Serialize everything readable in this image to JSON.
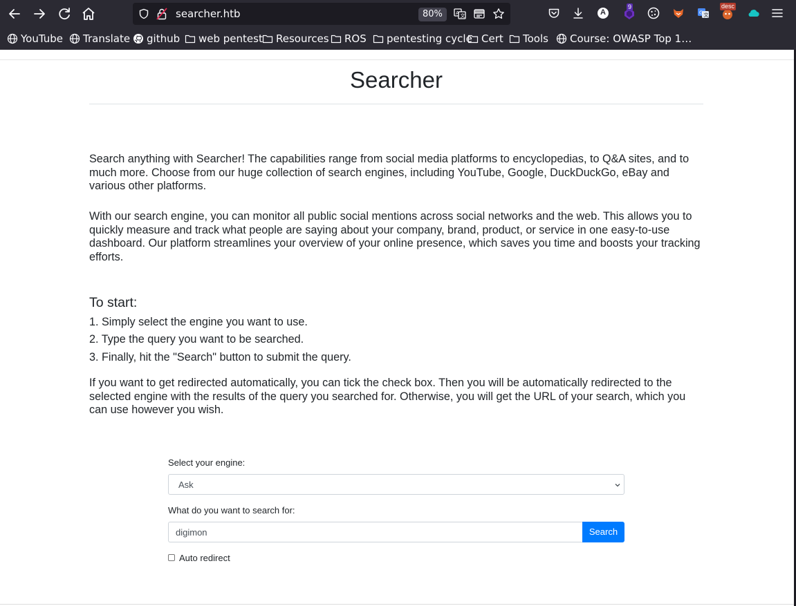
{
  "browser": {
    "url": "searcher.htb",
    "zoom": "80%",
    "extension_badges": {
      "ublock_count": "9",
      "ext_label": "desc",
      "profile_letter": "A"
    },
    "bookmarks": [
      {
        "label": "YouTube",
        "icon": "globe-icon"
      },
      {
        "label": "Translate",
        "icon": "globe-icon"
      },
      {
        "label": "github",
        "icon": "github-icon"
      },
      {
        "label": "web pentest",
        "icon": "folder-icon"
      },
      {
        "label": "Resources",
        "icon": "folder-icon"
      },
      {
        "label": "ROS",
        "icon": "folder-icon"
      },
      {
        "label": "pentesting cycle",
        "icon": "folder-icon"
      },
      {
        "label": "Cert",
        "icon": "folder-icon"
      },
      {
        "label": "Tools",
        "icon": "folder-icon"
      },
      {
        "label": "Course: OWASP Top 1…",
        "icon": "globe-icon"
      }
    ]
  },
  "page": {
    "title": "Searcher",
    "intro_1": "Search anything with Searcher! The capabilities range from social media platforms to encyclopedias, to Q&A sites, and to much more. Choose from our huge collection of search engines, including YouTube, Google, DuckDuckGo, eBay and various other platforms.",
    "intro_2": "With our search engine, you can monitor all public social mentions across social networks and the web. This allows you to quickly measure and track what people are saying about your company, brand, product, or service in one easy-to-use dashboard. Our platform streamlines your overview of your online presence, which saves you time and boosts your tracking efforts.",
    "start_heading": "To start:",
    "steps": [
      "1. Simply select the engine you want to use.",
      "2. Type the query you want to be searched.",
      "3. Finally, hit the \"Search\" button to submit the query."
    ],
    "redirect_note": "If you want to get redirected automatically, you can tick the check box. Then you will be automatically redirected to the selected engine with the results of the query you searched for. Otherwise, you will get the URL of your search, which you can use however you wish."
  },
  "form": {
    "engine_label": "Select your engine:",
    "engine_value": "Ask",
    "query_label": "What do you want to search for:",
    "query_value": "digimon",
    "search_button": "Search",
    "auto_redirect_label": "Auto redirect",
    "auto_redirect_checked": false
  }
}
